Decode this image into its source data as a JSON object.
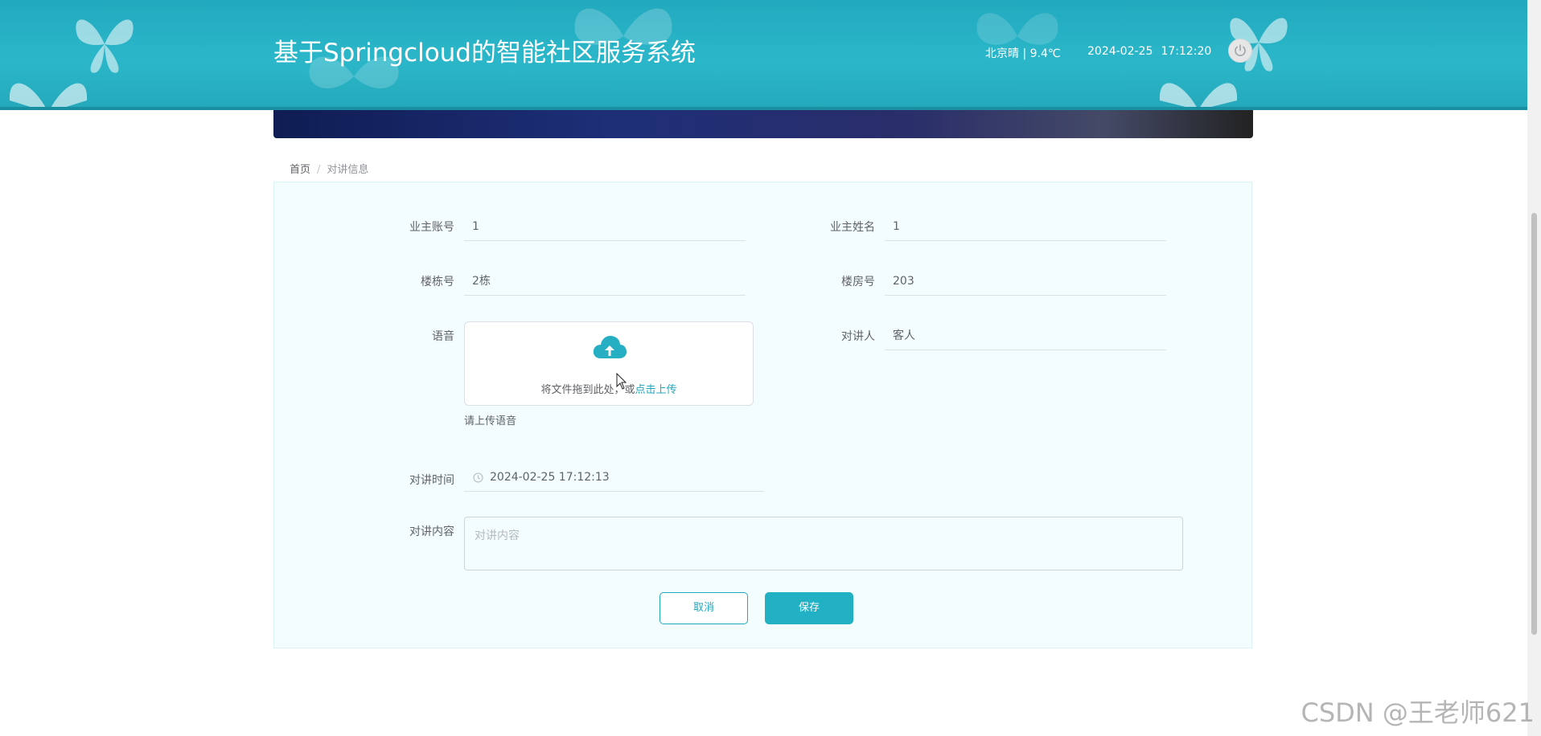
{
  "header": {
    "title": "基于Springcloud的智能社区服务系统",
    "weather": "北京晴 | 9.4℃",
    "date": "2024-02-25",
    "time": "17:12:20",
    "power_icon": "power-icon"
  },
  "breadcrumb": {
    "home": "首页",
    "separator": "/",
    "current": "对讲信息"
  },
  "form": {
    "owner_account": {
      "label": "业主账号",
      "value": "1"
    },
    "owner_name": {
      "label": "业主姓名",
      "value": "1"
    },
    "building_no": {
      "label": "楼栋号",
      "value": "2栋"
    },
    "room_no": {
      "label": "楼房号",
      "value": "203"
    },
    "voice": {
      "label": "语音",
      "drop_text": "将文件拖到此处，或",
      "click_text": "点击上传",
      "tip": "请上传语音",
      "icon": "upload-cloud-icon"
    },
    "intercom_person": {
      "label": "对讲人",
      "value": "客人"
    },
    "intercom_time": {
      "label": "对讲时间",
      "value": "2024-02-25 17:12:13",
      "icon": "clock-icon"
    },
    "intercom_content": {
      "label": "对讲内容",
      "placeholder": "对讲内容"
    },
    "cancel_label": "取消",
    "save_label": "保存"
  },
  "watermark": "CSDN @王老师621",
  "colors": {
    "header_bg": "#2bb7c9",
    "accent": "#20a8bd",
    "panel_bg": "#f4fdfe"
  }
}
